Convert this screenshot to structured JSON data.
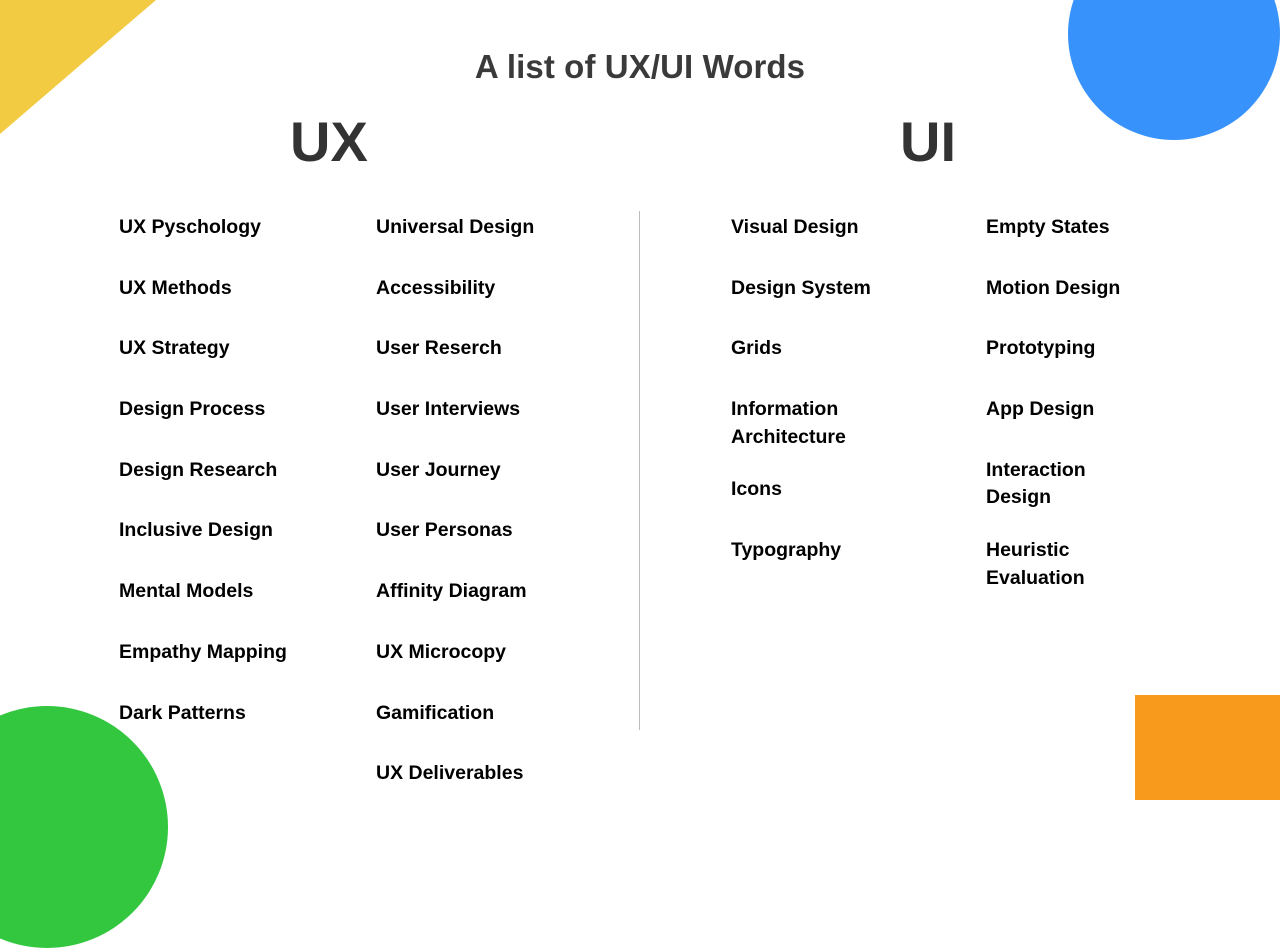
{
  "header": {
    "title": "A list of UX/UI Words"
  },
  "sections": [
    {
      "heading": "UX",
      "columns": [
        {
          "name": "ux-column-1",
          "items": [
            "UX Pyschology",
            "UX Methods",
            "UX Strategy",
            "Design Process",
            "Design Research",
            "Inclusive Design",
            "Mental Models",
            "Empathy Mapping",
            "Dark Patterns"
          ]
        },
        {
          "name": "ux-column-2",
          "items": [
            "Universal Design",
            "Accessibility",
            "User Reserch",
            "User Interviews",
            "User Journey",
            "User Personas",
            "Affinity Diagram",
            "UX Microcopy",
            "Gamification",
            "UX Deliverables"
          ]
        }
      ]
    },
    {
      "heading": "UI",
      "columns": [
        {
          "name": "ui-column-1",
          "items": [
            "Visual Design",
            "Design System",
            "Grids",
            "Information\nArchitecture",
            "Icons",
            "Typography"
          ]
        },
        {
          "name": "ui-column-2",
          "items": [
            "Empty States",
            "Motion Design",
            "Prototyping",
            "App Design",
            "Interaction\nDesign",
            "Heuristic\nEvaluation"
          ]
        }
      ]
    }
  ],
  "decorations": {
    "yellow_triangle_color": "#F2CB42",
    "blue_circle_color": "#3792FB",
    "green_circle_color": "#32C73F",
    "orange_rect_color": "#F89A1C",
    "divider_color": "#BDBDBD",
    "title_color": "#3A3A3A",
    "heading_color": "#333333",
    "word_color": "#000000",
    "background_color": "#FFFFFF"
  }
}
